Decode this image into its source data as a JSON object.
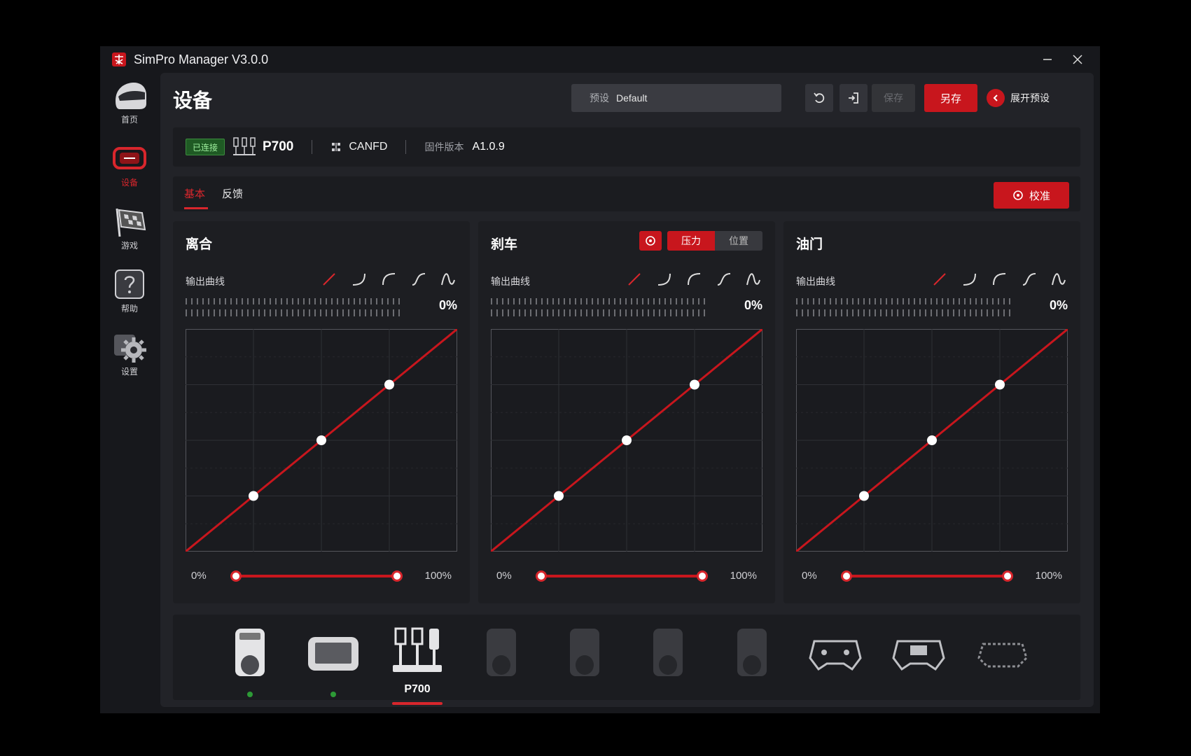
{
  "window": {
    "title": "SimPro Manager V3.0.0"
  },
  "sidebar": {
    "items": [
      {
        "label": "首页",
        "icon": "helmet-icon"
      },
      {
        "label": "设备",
        "icon": "wheelbase-icon"
      },
      {
        "label": "游戏",
        "icon": "racing-flag-icon"
      },
      {
        "label": "帮助",
        "icon": "help-icon"
      },
      {
        "label": "设置",
        "icon": "gear-icon"
      }
    ]
  },
  "header": {
    "title": "设备",
    "preset_prefix": "预设",
    "preset_value": "Default",
    "save_label": "保存",
    "saveas_label": "另存",
    "expand_label": "展开预设"
  },
  "device": {
    "status_badge": "已连接",
    "name": "P700",
    "protocol": "CANFD",
    "firmware_label": "固件版本",
    "firmware_version": "A1.0.9"
  },
  "tabs": [
    {
      "label": "基本"
    },
    {
      "label": "反馈"
    }
  ],
  "calibrate_label": "校准",
  "panels": [
    {
      "title": "离合",
      "curve_label": "输出曲线",
      "percent": "0%",
      "range_min": "0%",
      "range_max": "100%",
      "points": [
        [
          25,
          25
        ],
        [
          50,
          50
        ],
        [
          75,
          75
        ]
      ]
    },
    {
      "title": "刹车",
      "curve_label": "输出曲线",
      "percent": "0%",
      "range_min": "0%",
      "range_max": "100%",
      "mode_on": "压力",
      "mode_off": "位置",
      "points": [
        [
          25,
          25
        ],
        [
          50,
          50
        ],
        [
          75,
          75
        ]
      ]
    },
    {
      "title": "油门",
      "curve_label": "输出曲线",
      "percent": "0%",
      "range_min": "0%",
      "range_max": "100%",
      "points": [
        [
          25,
          25
        ],
        [
          50,
          50
        ],
        [
          75,
          75
        ]
      ]
    }
  ],
  "dock": {
    "active_label": "P700",
    "items": [
      {
        "icon": "wheelbase-device-icon",
        "connected": true
      },
      {
        "icon": "dashboard-device-icon",
        "connected": true
      },
      {
        "icon": "pedals-device-icon",
        "active": true
      },
      {
        "icon": "wheelbase-device-icon",
        "connected": false
      },
      {
        "icon": "wheelbase-device-icon",
        "connected": false
      },
      {
        "icon": "wheelbase-device-icon",
        "connected": false
      },
      {
        "icon": "wheelbase-device-icon",
        "connected": false
      },
      {
        "icon": "steering-wheel-device-icon",
        "connected": false
      },
      {
        "icon": "steering-wheel-device-icon",
        "connected": false
      },
      {
        "icon": "steering-wheel-device-icon",
        "connected": false
      }
    ]
  },
  "colors": {
    "accent": "#c8161d",
    "panel": "#1d1e22",
    "bg": "#17181c",
    "connected": "#2d9a36"
  }
}
